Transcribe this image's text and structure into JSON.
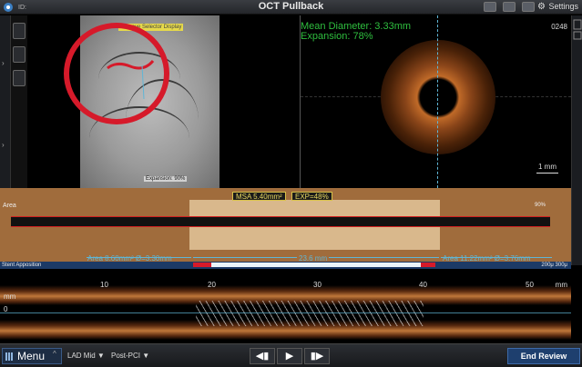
{
  "topbar": {
    "title": "OCT Pullback",
    "id_label": "ID:",
    "settings_label": "Settings"
  },
  "angio": {
    "overlay_tag": "Remove Selector Display",
    "expansion_label": "Expansion:",
    "expansion_scale": "90%"
  },
  "cross_section": {
    "mean_diameter": "Mean Diameter: 3.33mm",
    "expansion": "Expansion: 78%",
    "frame_number": "0248",
    "scale_label": "1 mm"
  },
  "area_panel": {
    "label": "Area",
    "msa": "MSA 5.40mm²",
    "exp": "EXP=48%",
    "scale_pct": "90%",
    "left_ref": "Area 8.60mm² Ø=3.30mm",
    "length": "23.6 mm",
    "right_ref": "Area 11.22mm² Ø=3.76mm"
  },
  "apposition": {
    "label": "Stent Apposition",
    "legend_1": "200μ",
    "legend_2": "300μ"
  },
  "longitudinal": {
    "ticks": [
      "10",
      "20",
      "30",
      "40",
      "50"
    ],
    "unit": "mm",
    "y_unit": "mm",
    "y_zero": "0"
  },
  "bottombar": {
    "menu_label": "Menu",
    "vessel": "LAD Mid",
    "stage": "Post-PCI",
    "end_review": "End Review",
    "prev_symbol": "◀▮",
    "play_symbol": "▶",
    "next_symbol": "▮▶"
  },
  "colors": {
    "accent_blue": "#5fb6d6",
    "measure_green": "#2fbf3f",
    "highlight_red": "#d61a2a",
    "label_yellow": "#e8d860"
  }
}
